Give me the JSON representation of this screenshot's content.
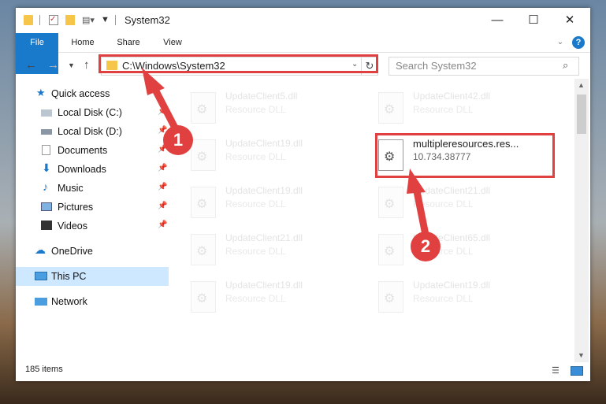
{
  "window": {
    "title": "System32"
  },
  "ribbon": {
    "tabs": [
      "File",
      "Home",
      "Share",
      "View"
    ]
  },
  "nav": {
    "address": "C:\\Windows\\System32",
    "search_placeholder": "Search System32"
  },
  "sidebar": {
    "quick_access": "Quick access",
    "items": [
      {
        "label": "Local Disk (C:)"
      },
      {
        "label": "Local Disk (D:)"
      },
      {
        "label": "Documents"
      },
      {
        "label": "Downloads"
      },
      {
        "label": "Music"
      },
      {
        "label": "Pictures"
      },
      {
        "label": "Videos"
      }
    ],
    "onedrive": "OneDrive",
    "this_pc": "This PC",
    "network": "Network"
  },
  "files": [
    {
      "name": "UpdateClient5.dll",
      "type": "Resource DLL"
    },
    {
      "name": "UpdateClient42.dll",
      "type": "Resource DLL"
    },
    {
      "name": "UpdateClient19.dll",
      "type": "Resource DLL"
    },
    {
      "name": "multipleresources.res...",
      "type": "10.734.38777"
    },
    {
      "name": "UpdateClient19.dll",
      "type": "Resource DLL"
    },
    {
      "name": "UpdateClient21.dll",
      "type": "Resource DLL"
    },
    {
      "name": "UpdateClient21.dll",
      "type": "Resource DLL"
    },
    {
      "name": "UpdateClient65.dll",
      "type": "Resource DLL"
    },
    {
      "name": "UpdateClient19.dll",
      "type": "Resource DLL"
    },
    {
      "name": "UpdateClient19.dll",
      "type": "Resource DLL"
    }
  ],
  "status": {
    "count": "185 items"
  },
  "annotations": {
    "badge1": "1",
    "badge2": "2"
  },
  "colors": {
    "accent": "#1979ca",
    "highlight": "#e0403f"
  }
}
